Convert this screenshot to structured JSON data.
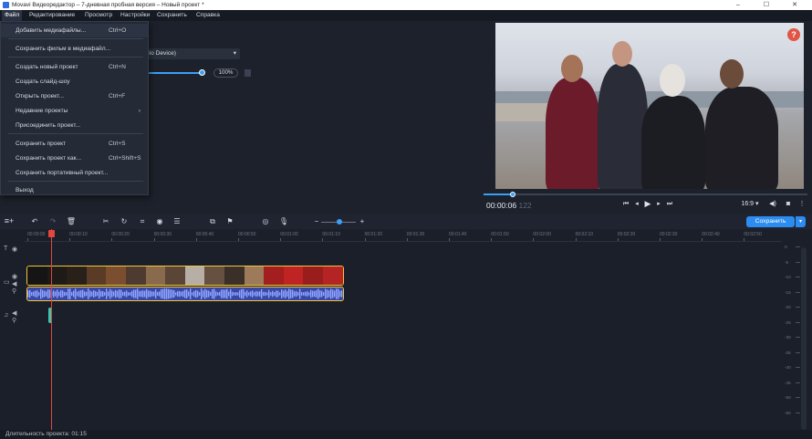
{
  "window": {
    "title": "Movavi Видеоредактор – 7-дневная пробная версия – Новый проект *",
    "minimize": "–",
    "maximize": "☐",
    "close": "✕"
  },
  "menubar": {
    "items": [
      "Файл",
      "Редактирование",
      "Просмотр",
      "Настройки",
      "Сохранить",
      "Справка"
    ]
  },
  "file_menu": {
    "items": [
      {
        "label": "Добавить медиафайлы...",
        "shortcut": "Ctrl+O"
      },
      {
        "label": "Сохранить фильм в медиафайл...",
        "shortcut": ""
      },
      {
        "label": "Создать новый проект",
        "shortcut": "Ctrl+N"
      },
      {
        "label": "Создать слайд-шоу",
        "shortcut": ""
      },
      {
        "label": "Открыть проект...",
        "shortcut": "Ctrl+F"
      },
      {
        "label": "Недавние проекты",
        "shortcut": "",
        "arrow": "›"
      },
      {
        "label": "Присоединить проект...",
        "shortcut": ""
      },
      {
        "label": "Сохранить проект",
        "shortcut": "Ctrl+S"
      },
      {
        "label": "Сохранить проект как...",
        "shortcut": "Ctrl+Shift+S"
      },
      {
        "label": "Сохранить портативный проект...",
        "shortcut": ""
      },
      {
        "label": "Выход",
        "shortcut": ""
      }
    ]
  },
  "audio_panel": {
    "device": "l Audio Device)",
    "dropdown_arrow": "▾",
    "volume_percent": 100,
    "volume_label": "100%"
  },
  "preview": {
    "help": "?",
    "timecode_main": "00:00:06",
    "timecode_frames": "122",
    "progress_fraction": 0.09,
    "aspect_ratio": "16:9 ▾",
    "controls": [
      "prev-clip",
      "prev-frame",
      "play",
      "next-frame",
      "next-clip"
    ]
  },
  "toolbar": {
    "save_label": "Сохранить",
    "save_arrow": "▾",
    "zoom_minus": "−",
    "zoom_plus": "+"
  },
  "timeline": {
    "ruler": [
      "00:00:00",
      "00:00:10",
      "00:00:20",
      "00:00:30",
      "00:00:40",
      "00:00:50",
      "00:01:00",
      "00:01:10",
      "00:01:20",
      "00:01:30",
      "00:01:40",
      "00:01:50",
      "00:02:00",
      "00:02:10",
      "00:02:20",
      "00:02:30",
      "00:02:40",
      "00:02:50"
    ],
    "meter_labels": [
      "0",
      "-5",
      "-10",
      "-15",
      "-20",
      "-25",
      "-30",
      "-35",
      "-40",
      "-45",
      "-50",
      "-60"
    ]
  },
  "status": {
    "duration": "Длительность проекта: 01:15"
  },
  "colors": {
    "accent": "#2d8cf0",
    "playhead": "#e2463f",
    "clip_border": "#f3c43b",
    "audio_clip": "#3a47a4"
  }
}
